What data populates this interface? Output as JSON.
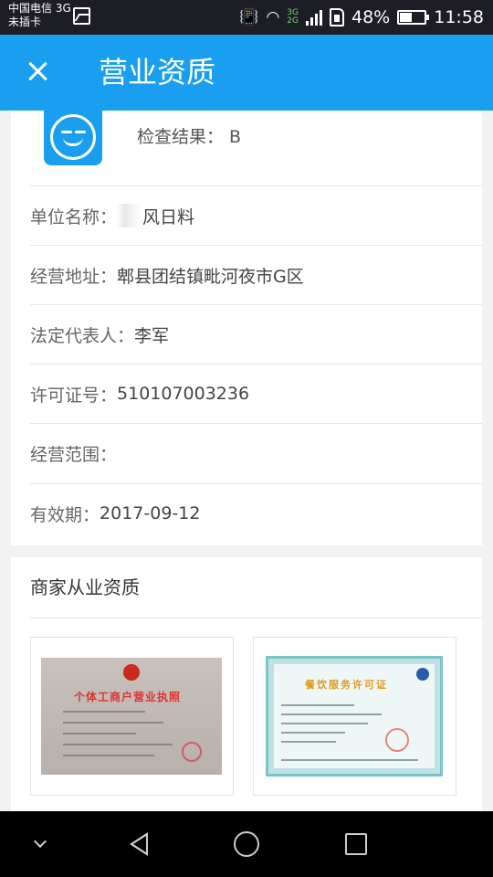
{
  "status_bar": {
    "carrier_line1": "中国电信 3G",
    "carrier_line2": "未插卡",
    "network_top": "3G",
    "network_bottom": "2G",
    "battery": "48%",
    "battery_level": 0.48,
    "time": "11:58"
  },
  "app_bar": {
    "title": "营业资质",
    "close_icon": "close-icon"
  },
  "info": {
    "check_result": "检查结果： B",
    "unit_name_label": "单位名称：",
    "unit_name_value": "风日料",
    "address_label": "经营地址：",
    "address_value": "郫县团结镇毗河夜市G区",
    "legal_rep_label": "法定代表人：",
    "legal_rep_value": "李军",
    "license_label": "许可证号：",
    "license_value": "510107003236",
    "scope_label": "经营范围：",
    "scope_value": "",
    "validity_label": "有效期：",
    "validity_value": "2017-09-12"
  },
  "qualifications": {
    "title": "商家从业资质",
    "images": [
      {
        "title": "个体工商户营业执照"
      },
      {
        "title": "餐饮服务许可证"
      }
    ]
  },
  "nav_bar": {
    "icons": [
      "chevron-down-icon",
      "back-icon",
      "home-icon",
      "recents-icon"
    ]
  },
  "colors": {
    "primary": "#1a9ff0",
    "status_bar": "#1d1d25",
    "nav_bar": "#000000"
  }
}
